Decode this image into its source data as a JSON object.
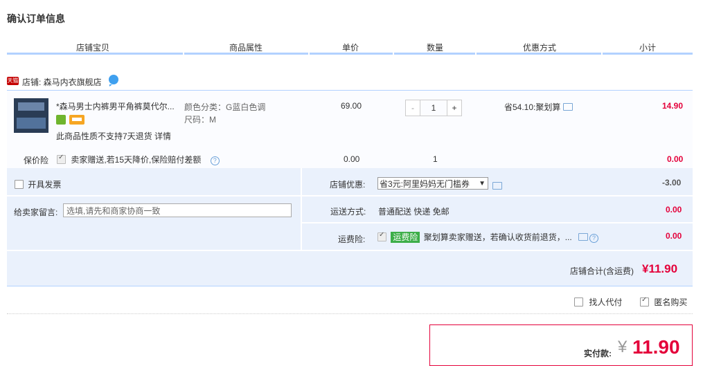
{
  "title": "确认订单信息",
  "columns": [
    "店铺宝贝",
    "商品属性",
    "单价",
    "数量",
    "优惠方式",
    "小计"
  ],
  "shop": {
    "badge": "天猫",
    "label": "店铺: 森马内衣旗舰店"
  },
  "item": {
    "name": "*森马男士内裤男平角裤莫代尔...",
    "note": "此商品性质不支持7天退货 详情",
    "attr_color": "颜色分类：G蓝白色调",
    "attr_size": "尺码：M",
    "price": "69.00",
    "quantity": "1",
    "minus": "-",
    "plus": "+",
    "promo": "省54.10:聚划算",
    "subtotal": "14.90"
  },
  "insurance": {
    "label": "保价险",
    "desc": "卖家赠送,若15天降价,保险赔付差额",
    "price": "0.00",
    "qty": "1",
    "subtotal": "0.00"
  },
  "invoice_label": "开具发票",
  "memo": {
    "label": "给卖家留言:",
    "placeholder": "选填,请先和商家协商一致"
  },
  "shop_discount": {
    "label": "店铺优惠:",
    "selected": "省3元:阿里妈妈无门槛券",
    "amount": "-3.00"
  },
  "shipping": {
    "label": "运送方式:",
    "value": "普通配送 快递 免邮",
    "amount": "0.00"
  },
  "freight_ins": {
    "label": "运费险:",
    "tag": "运费险",
    "desc": "聚划算卖家赠送，若确认收货前退货，...",
    "amount": "0.00"
  },
  "shop_total": {
    "label": "店铺合计(含运费)",
    "value": "¥11.90"
  },
  "options": {
    "proxy_pay": "找人代付",
    "anonymous": "匿名购买"
  },
  "pay": {
    "label": "实付款:",
    "currency": "¥",
    "value": "11.90"
  },
  "colors": {
    "accent": "#e4003a",
    "line": "#b2d1ff",
    "panel": "#eaf1fc"
  }
}
